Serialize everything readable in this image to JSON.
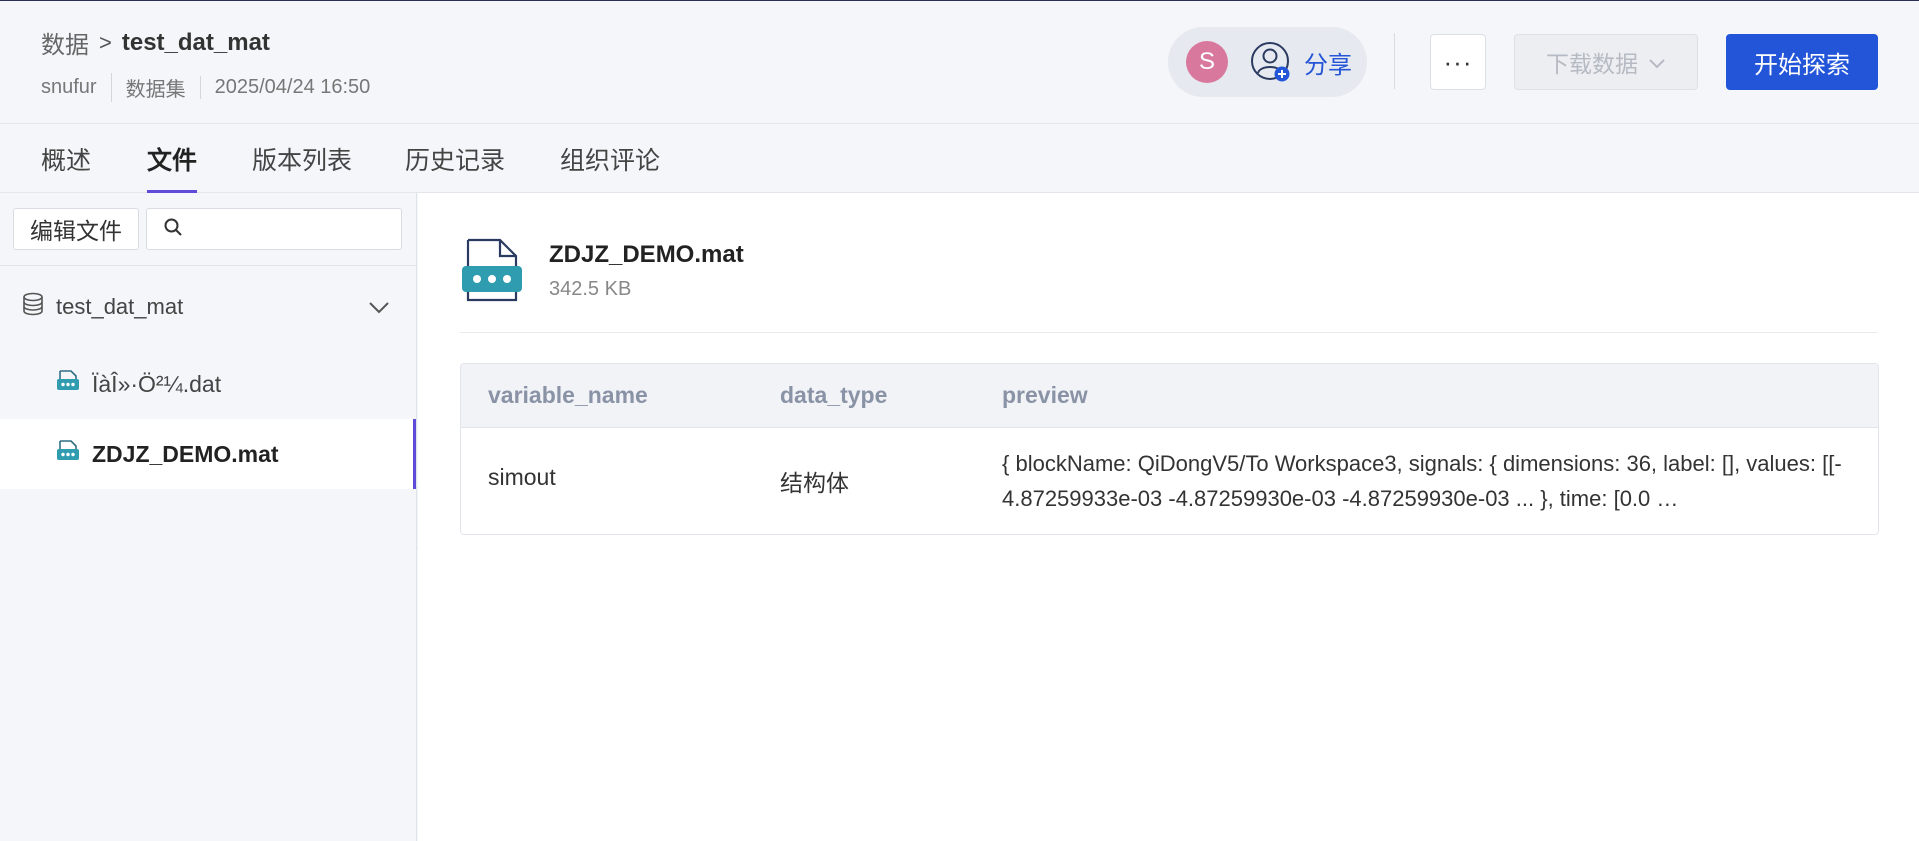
{
  "header": {
    "breadcrumb": {
      "parent": "数据",
      "separator": ">",
      "current": "test_dat_mat"
    },
    "meta": {
      "owner": "snufur",
      "type": "数据集",
      "date": "2025/04/24 16:50"
    },
    "avatar_initial": "S",
    "share_label": "分享",
    "more_label": "···",
    "download_label": "下载数据",
    "explore_label": "开始探索"
  },
  "tabs": [
    {
      "label": "概述",
      "active": false
    },
    {
      "label": "文件",
      "active": true
    },
    {
      "label": "版本列表",
      "active": false
    },
    {
      "label": "历史记录",
      "active": false
    },
    {
      "label": "组织评论",
      "active": false
    }
  ],
  "sidebar": {
    "edit_label": "编辑文件",
    "search_placeholder": "",
    "root": {
      "label": "test_dat_mat"
    },
    "items": [
      {
        "label": "ÏàÎ»·Ö²¼.dat",
        "selected": false
      },
      {
        "label": "ZDJZ_DEMO.mat",
        "selected": true
      }
    ]
  },
  "file": {
    "name": "ZDJZ_DEMO.mat",
    "size": "342.5 KB"
  },
  "table": {
    "headers": [
      "variable_name",
      "data_type",
      "preview"
    ],
    "rows": [
      {
        "variable_name": "simout",
        "data_type": "结构体",
        "preview": "{ blockName: QiDongV5/To Workspace3, signals: { dimensions: 36, label: [], values: [[-4.87259933e-03 -4.87259930e-03 -4.87259930e-03 ... }, time: [0.0 …"
      }
    ]
  },
  "colors": {
    "accent": "#2355d8",
    "tab_indicator": "#5e4bd8",
    "avatar": "#d9789d",
    "file_icon": "#2f9cb0"
  }
}
